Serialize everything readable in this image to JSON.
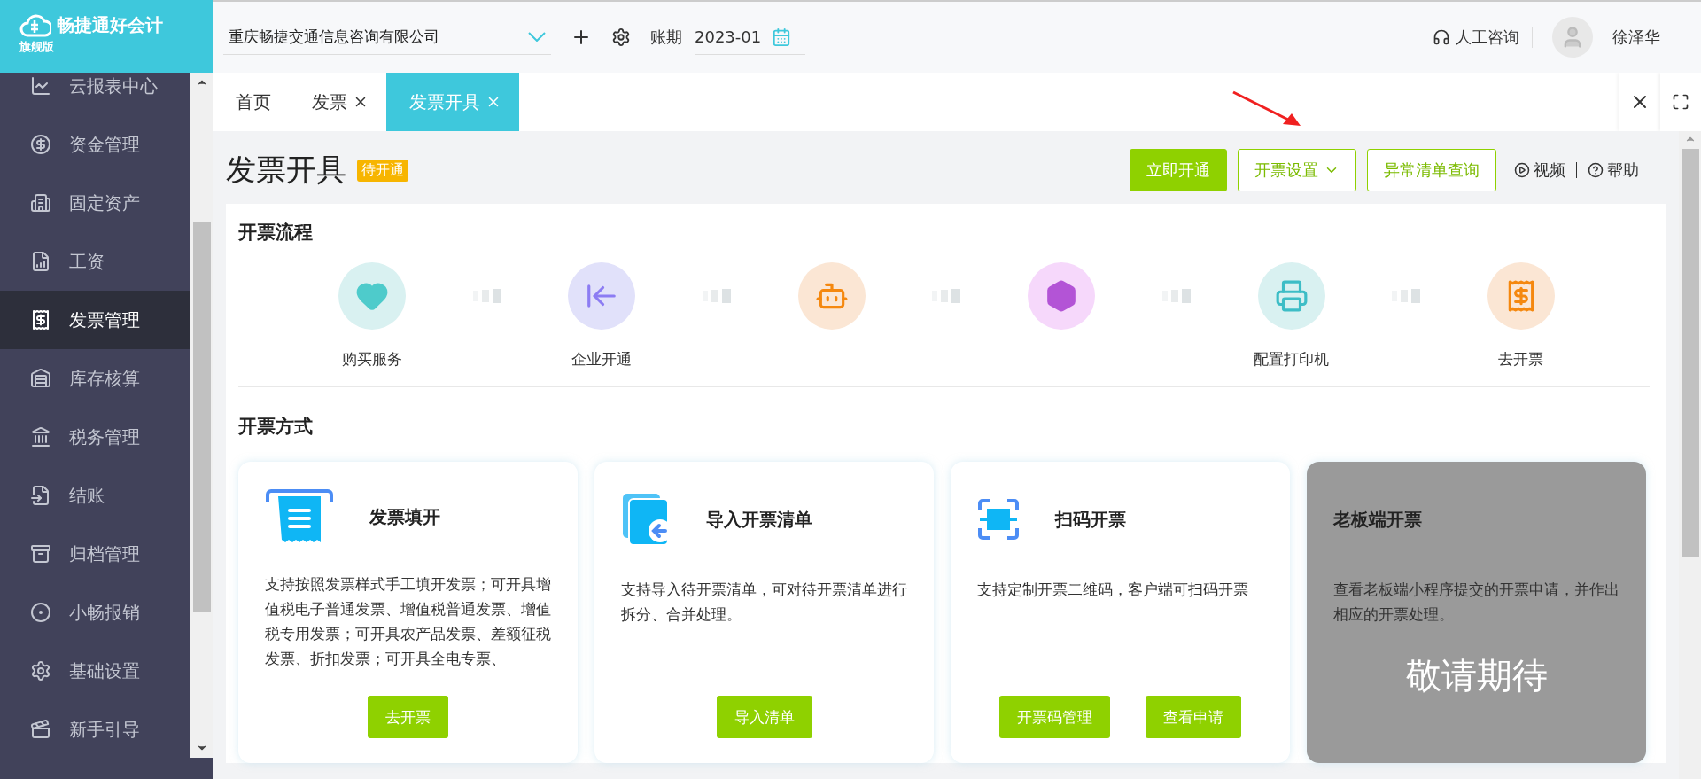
{
  "app": {
    "name": "畅捷通好会计",
    "edition": "旗舰版"
  },
  "header": {
    "company": "重庆畅捷交通信息咨询有限公司",
    "period_label": "账期",
    "period": "2023-01",
    "support": "人工咨询",
    "user": "徐泽华"
  },
  "sidebar": {
    "items": [
      {
        "label": "云报表中心",
        "selected": false
      },
      {
        "label": "资金管理",
        "selected": false
      },
      {
        "label": "固定资产",
        "selected": false
      },
      {
        "label": "工资",
        "selected": false
      },
      {
        "label": "发票管理",
        "selected": true
      },
      {
        "label": "库存核算",
        "selected": false
      },
      {
        "label": "税务管理",
        "selected": false
      },
      {
        "label": "结账",
        "selected": false
      },
      {
        "label": "归档管理",
        "selected": false
      },
      {
        "label": "小畅报销",
        "selected": false
      },
      {
        "label": "基础设置",
        "selected": false
      },
      {
        "label": "新手引导",
        "selected": false
      }
    ]
  },
  "tabs": [
    {
      "label": "首页",
      "selected": false,
      "closable": false
    },
    {
      "label": "发票",
      "selected": false,
      "closable": true
    },
    {
      "label": "发票开具",
      "selected": true,
      "closable": true
    }
  ],
  "page": {
    "title": "发票开具",
    "status": "待开通",
    "actions": [
      {
        "label": "立即开通",
        "kind": "primary"
      },
      {
        "label": "开票设置",
        "kind": "dropdown"
      },
      {
        "label": "异常清单查询",
        "kind": "outline"
      }
    ],
    "video": "视频",
    "help": "帮助"
  },
  "process": {
    "title": "开票流程",
    "steps": [
      {
        "kind": "heart",
        "label": "购买服务"
      },
      {
        "kind": "import",
        "label": "企业开通"
      },
      {
        "kind": "robot"
      },
      {
        "kind": "tax"
      },
      {
        "kind": "printer",
        "label": "配置打印机"
      },
      {
        "kind": "receipt",
        "label": "去开票"
      }
    ]
  },
  "methods": {
    "title": "开票方式",
    "cards": [
      {
        "kind": "receipt",
        "title": "发票填开",
        "description": "支持按照发票样式手工填开发票；可开具增值税电子普通发票、增值税普通发票、增值税专用发票；可开具农产品发票、差额征税发票、折扣发票；可开具全电专票、",
        "buttons": [
          "去开票"
        ],
        "disabled": false
      },
      {
        "kind": "import",
        "title": "导入开票清单",
        "description": "支持导入待开票清单，可对待开票清单进行拆分、合并处理。",
        "buttons": [
          "导入清单"
        ],
        "disabled": false
      },
      {
        "kind": "scan",
        "title": "扫码开票",
        "description": "支持定制开票二维码，客户端可扫码开票",
        "buttons": [
          "开票码管理",
          "查看申请"
        ],
        "disabled": false
      },
      {
        "kind": "none",
        "title": "老板端开票",
        "description": "查看老板端小程序提交的开票申请，并作出相应的开票处理。",
        "disabled": true,
        "overlay": "敬请期待"
      }
    ]
  }
}
